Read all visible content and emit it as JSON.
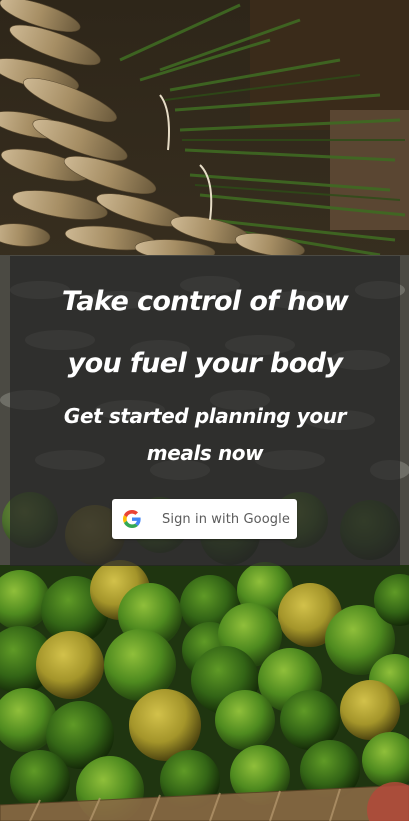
{
  "hero": {
    "headline_line1": "Take control of how",
    "headline_line2": "you fuel your body",
    "subheadline_line1": "Get started planning your",
    "subheadline_line2": "meals now"
  },
  "auth": {
    "google_button_label": "Sign in with Google",
    "icon": "google-g-icon"
  },
  "colors": {
    "panel_overlay": "#262626",
    "text": "#ffffff",
    "button_bg": "#ffffff",
    "button_text": "#5b5b5b",
    "google_blue": "#4285F4",
    "google_red": "#EA4335",
    "google_yellow": "#FBBC05",
    "google_green": "#34A853"
  },
  "background": {
    "description_icon": "produce-photo"
  }
}
